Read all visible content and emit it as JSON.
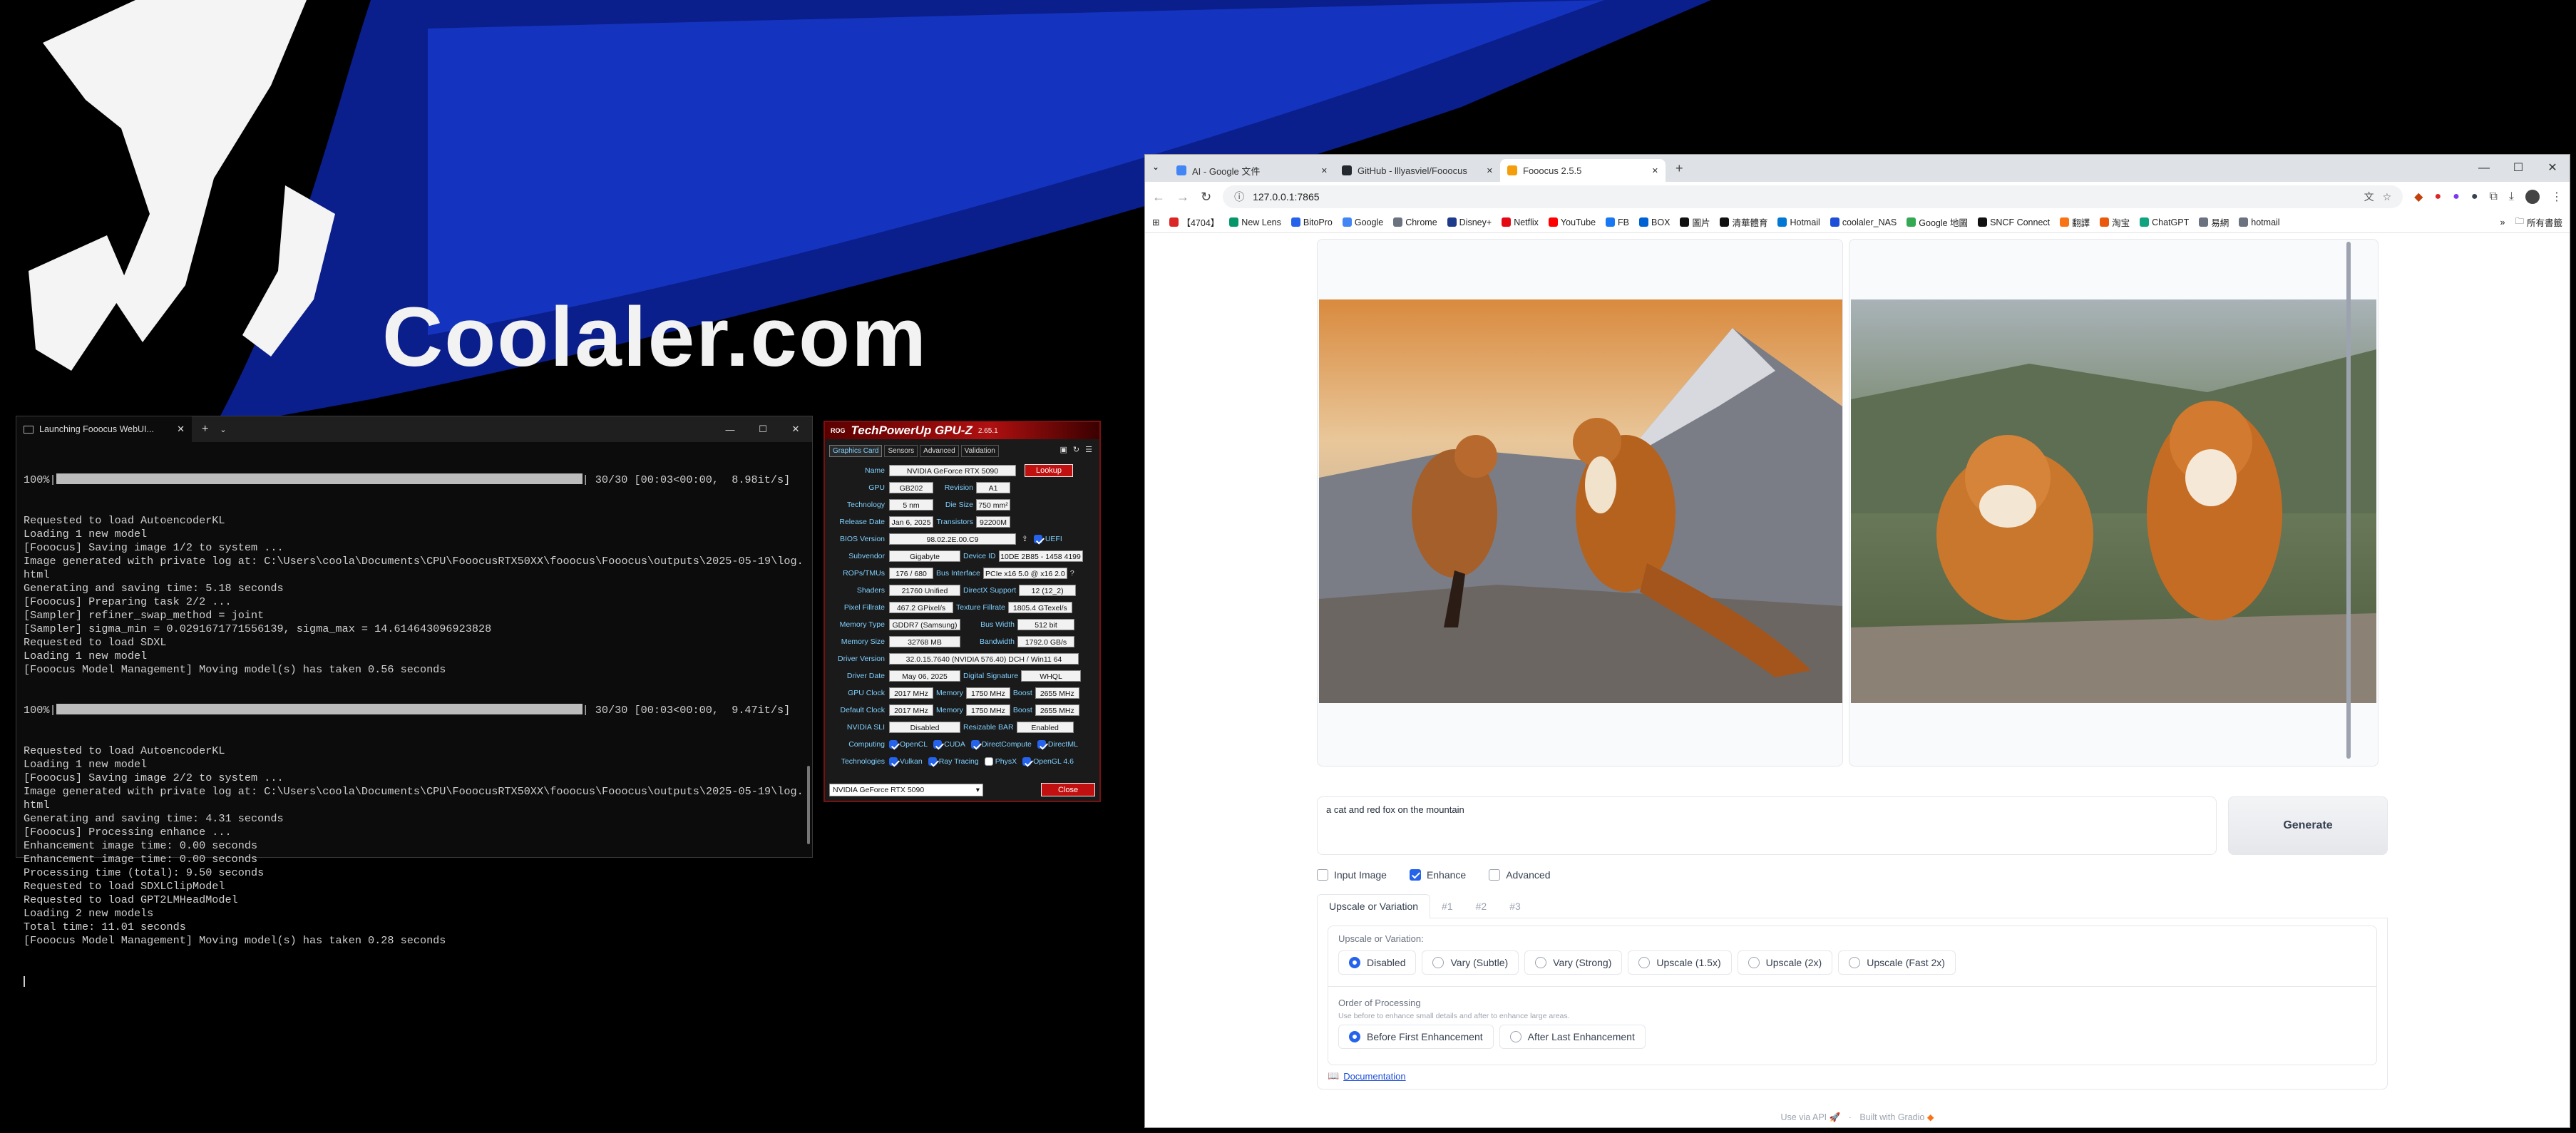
{
  "desktop": {
    "wallpaper_text": "Coolaler.com"
  },
  "terminal": {
    "tab_title": "Launching Fooocus WebUI...",
    "progress": [
      {
        "before": "100%|",
        "after": "| 30/30 [00:03<00:00,  8.98it/s]",
        "fraction": 1.0
      },
      {
        "before": "100%|",
        "after": "| 30/30 [00:03<00:00,  9.47it/s]",
        "fraction": 1.0
      }
    ],
    "lines_a": [
      "Requested to load AutoencoderKL",
      "Loading 1 new model",
      "[Fooocus] Saving image 1/2 to system ...",
      "Image generated with private log at: C:\\Users\\coola\\Documents\\CPU\\FooocusRTX50XX\\fooocus\\Fooocus\\outputs\\2025-05-19\\log.",
      "html",
      "Generating and saving time: 5.18 seconds",
      "[Fooocus] Preparing task 2/2 ...",
      "[Sampler] refiner_swap_method = joint",
      "[Sampler] sigma_min = 0.0291671771556139, sigma_max = 14.614643096923828",
      "Requested to load SDXL",
      "Loading 1 new model",
      "[Fooocus Model Management] Moving model(s) has taken 0.56 seconds"
    ],
    "lines_b": [
      "Requested to load AutoencoderKL",
      "Loading 1 new model",
      "[Fooocus] Saving image 2/2 to system ...",
      "Image generated with private log at: C:\\Users\\coola\\Documents\\CPU\\FooocusRTX50XX\\fooocus\\Fooocus\\outputs\\2025-05-19\\log.",
      "html",
      "Generating and saving time: 4.31 seconds",
      "[Fooocus] Processing enhance ...",
      "Enhancement image time: 0.00 seconds",
      "Enhancement image time: 0.00 seconds",
      "Processing time (total): 9.50 seconds",
      "Requested to load SDXLClipModel",
      "Requested to load GPT2LMHeadModel",
      "Loading 2 new models",
      "Total time: 11.01 seconds",
      "[Fooocus Model Management] Moving model(s) has taken 0.28 seconds"
    ]
  },
  "gpuz": {
    "title": "TechPowerUp GPU-Z",
    "version": "2.65.1",
    "tabs": [
      "Graphics Card",
      "Sensors",
      "Advanced",
      "Validation"
    ],
    "lookup": "Lookup",
    "uefi": "UEFI",
    "close": "Close",
    "selected_gpu": "NVIDIA GeForce RTX 5090",
    "labels": {
      "name": "Name",
      "gpu": "GPU",
      "revision": "Revision",
      "technology": "Technology",
      "die_size": "Die Size",
      "release_date": "Release Date",
      "transistors": "Transistors",
      "bios": "BIOS Version",
      "subvendor": "Subvendor",
      "device_id": "Device ID",
      "rops": "ROPs/TMUs",
      "bus_interface": "Bus Interface",
      "shaders": "Shaders",
      "directx": "DirectX Support",
      "pixel_fillrate": "Pixel Fillrate",
      "texture_fillrate": "Texture Fillrate",
      "memory_type": "Memory Type",
      "bus_width": "Bus Width",
      "memory_size": "Memory Size",
      "bandwidth": "Bandwidth",
      "driver_version": "Driver Version",
      "driver_date": "Driver Date",
      "digital_signature": "Digital Signature",
      "gpu_clock": "GPU Clock",
      "memory": "Memory",
      "boost": "Boost",
      "default_clock": "Default Clock",
      "nvidia_sli": "NVIDIA SLI",
      "resizable_bar": "Resizable BAR",
      "computing": "Computing",
      "technologies": "Technologies"
    },
    "values": {
      "name": "NVIDIA GeForce RTX 5090",
      "gpu": "GB202",
      "revision": "A1",
      "technology": "5 nm",
      "die_size": "750 mm²",
      "release_date": "Jan 6, 2025",
      "transistors": "92200M",
      "bios": "98.02.2E.00.C9",
      "subvendor": "Gigabyte",
      "device_id": "10DE 2B85 - 1458 4199",
      "rops": "176 / 680",
      "bus_interface": "PCIe x16 5.0 @ x16 2.0",
      "shaders": "21760 Unified",
      "directx": "12 (12_2)",
      "pixel_fillrate": "467.2 GPixel/s",
      "texture_fillrate": "1805.4 GTexel/s",
      "memory_type": "GDDR7 (Samsung)",
      "bus_width": "512 bit",
      "memory_size": "32768 MB",
      "bandwidth": "1792.0 GB/s",
      "driver_version": "32.0.15.7640 (NVIDIA 576.40) DCH / Win11 64",
      "driver_date": "May 06, 2025",
      "digital_signature": "WHQL",
      "gpu_clock": "2017 MHz",
      "gpu_memory": "1750 MHz",
      "gpu_boost": "2655 MHz",
      "def_clock": "2017 MHz",
      "def_memory": "1750 MHz",
      "def_boost": "2655 MHz",
      "sli": "Disabled",
      "rebar": "Enabled"
    },
    "computing": [
      "OpenCL",
      "CUDA",
      "DirectCompute",
      "DirectML"
    ],
    "technologies": [
      "Vulkan",
      "Ray Tracing",
      "PhysX",
      "OpenGL 4.6"
    ]
  },
  "browser": {
    "tabs": [
      {
        "title": "AI - Google 文件",
        "color": "#4285f4"
      },
      {
        "title": "GitHub - lllyasviel/Fooocus",
        "color": "#24292f"
      },
      {
        "title": "Fooocus 2.5.5",
        "color": "#f59e0b"
      }
    ],
    "url": "127.0.0.1:7865",
    "bookmarks": [
      "【4704】",
      "New Lens",
      "BitoPro",
      "Google",
      "Chrome",
      "Disney+",
      "Netflix",
      "YouTube",
      "FB",
      "BOX",
      "圖片",
      "清華體育",
      "Hotmail",
      "coolaler_NAS",
      "Google 地圖",
      "SNCF Connect",
      "翻譯",
      "淘宝",
      "ChatGPT",
      "易網",
      "hotmail"
    ],
    "all_bookmarks": "所有書籤"
  },
  "fooocus": {
    "prompt": "a cat and red fox on the mountain",
    "generate": "Generate",
    "options": [
      {
        "label": "Input Image",
        "checked": false
      },
      {
        "label": "Enhance",
        "checked": true
      },
      {
        "label": "Advanced",
        "checked": false
      }
    ],
    "tabs": [
      "Upscale or Variation",
      "#1",
      "#2",
      "#3"
    ],
    "uov_label": "Upscale or Variation:",
    "uov_choices": [
      "Disabled",
      "Vary (Subtle)",
      "Vary (Strong)",
      "Upscale (1.5x)",
      "Upscale (2x)",
      "Upscale (Fast 2x)"
    ],
    "order_label": "Order of Processing",
    "order_hint": "Use before to enhance small details and after to enhance large areas.",
    "order_choices": [
      "Before First Enhancement",
      "After Last Enhancement"
    ],
    "docs": "Documentation",
    "footer_api": "Use via API",
    "footer_built": "Built with Gradio"
  }
}
